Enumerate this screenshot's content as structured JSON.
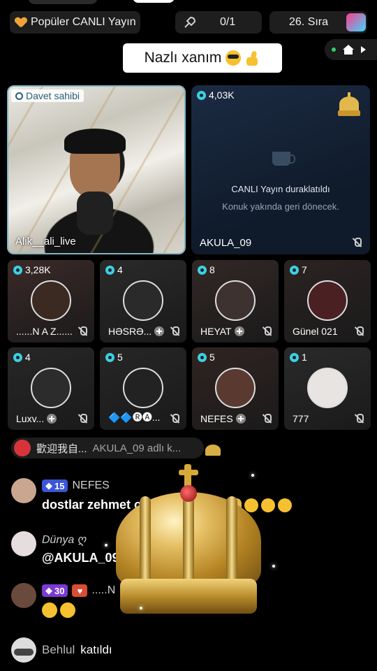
{
  "topbar": {
    "popular_label": "Popüler CANLI Yayın",
    "counter": "0/1",
    "rank": "26. Sıra"
  },
  "title": "Nazlı xanım",
  "host_tile": {
    "tag": "Davet sahibi",
    "name": "Alik__ali_live"
  },
  "paused_tile": {
    "viewers": "4,03K",
    "title": "CANLI Yayın duraklatıldı",
    "subtitle": "Konuk yakında geri dönecek.",
    "name": "AKULA_09"
  },
  "guests": [
    {
      "viewers": "3,28K",
      "name": "......N A Z......",
      "avatar_color": "#3a2a22"
    },
    {
      "viewers": "4",
      "name": "HƏSRƏ...",
      "avatar_color": "#2a2a2a"
    },
    {
      "viewers": "8",
      "name": "HEYAT",
      "avatar_color": "#3e3230"
    },
    {
      "viewers": "7",
      "name": "Günel 021",
      "avatar_color": "#4a2022"
    },
    {
      "viewers": "4",
      "name": "Luxv...",
      "avatar_color": "#2c2c2c"
    },
    {
      "viewers": "5",
      "name": "🔷🔷🅡🅐...",
      "avatar_color": "#222"
    },
    {
      "viewers": "5",
      "name": "NEFES",
      "avatar_color": "#5a3a30"
    },
    {
      "viewers": "1",
      "name": "777",
      "avatar_color": "#e8e4e2"
    }
  ],
  "chat": {
    "welcome_text": "歡迎我自...",
    "welcome_sub": "AKULA_09 adlı k...",
    "messages": [
      {
        "level": "15",
        "name": "NEFES",
        "text": "dostlar zehmet olmasa    olun"
      },
      {
        "name": "Dünya ღ",
        "text": "@AKULA_09"
      },
      {
        "level": "30",
        "name": ".....N",
        "text": ""
      }
    ],
    "join": {
      "name": "Behlul",
      "action": "katıldı"
    }
  },
  "colors": {
    "accent_eye": "#3dd0e0",
    "host_border": "#7fb4c4",
    "level_blue": "#3b57d6",
    "level_purple": "#7b3ad4"
  }
}
